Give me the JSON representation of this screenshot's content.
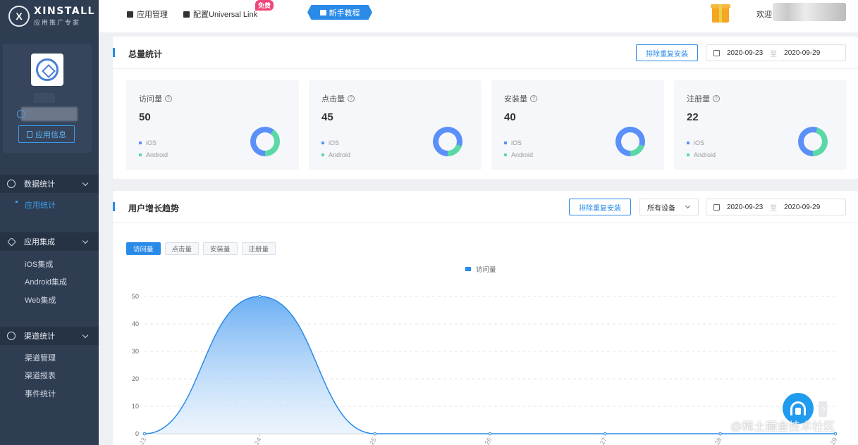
{
  "brand": {
    "name": "XINSTALL",
    "subtitle": "应用推广专家",
    "logo_mark": "X"
  },
  "sidebar": {
    "app_info_button": "应用信息",
    "groups": [
      {
        "label": "数据统计",
        "items": [
          {
            "label": "应用统计",
            "active": true
          }
        ]
      },
      {
        "label": "应用集成",
        "items": [
          {
            "label": "iOS集成"
          },
          {
            "label": "Android集成"
          },
          {
            "label": "Web集成"
          }
        ]
      },
      {
        "label": "渠道统计",
        "items": [
          {
            "label": "渠道管理"
          },
          {
            "label": "渠道报表"
          },
          {
            "label": "事件统计"
          }
        ]
      }
    ]
  },
  "topbar": {
    "app_manage": "应用管理",
    "universal_link": "配置Universal Link",
    "free_badge": "免费",
    "guide": "新手教程",
    "welcome": "欢迎"
  },
  "totals": {
    "title": "总量统计",
    "exclude_button": "排除重复安装",
    "date_start": "2020-09-23",
    "date_sep": "至",
    "date_end": "2020-09-29",
    "cards": [
      {
        "label": "访问量",
        "value": "50",
        "ios_fraction": 0.6
      },
      {
        "label": "点击量",
        "value": "45",
        "ios_fraction": 0.8
      },
      {
        "label": "安装量",
        "value": "40",
        "ios_fraction": 0.8
      },
      {
        "label": "注册量",
        "value": "22",
        "ios_fraction": 0.55
      }
    ],
    "legend_ios": "iOS",
    "legend_android": "Android",
    "colors": {
      "ios": "#5b8ff9",
      "android": "#5ad8a6"
    }
  },
  "growth": {
    "title": "用户增长趋势",
    "exclude_button": "排除重复安装",
    "device_select": "所有设备",
    "date_start": "2020-09-23",
    "date_sep": "至",
    "date_end": "2020-09-29",
    "tabs": [
      {
        "label": "访问量",
        "active": true
      },
      {
        "label": "点击量"
      },
      {
        "label": "安装量"
      },
      {
        "label": "注册量"
      }
    ]
  },
  "chart_data": {
    "type": "area",
    "series": [
      {
        "name": "访问量",
        "values": [
          0,
          50,
          0,
          0,
          0,
          0,
          0
        ]
      }
    ],
    "x": [
      "23",
      "24",
      "25",
      "26",
      "27",
      "28",
      "29"
    ],
    "yticks": [
      0,
      10,
      20,
      30,
      40,
      50
    ],
    "ylim": [
      0,
      55
    ],
    "grid": true,
    "legend": "top-center",
    "color": "#2a8ae8"
  },
  "watermark": "@稀土掘金技术社区"
}
